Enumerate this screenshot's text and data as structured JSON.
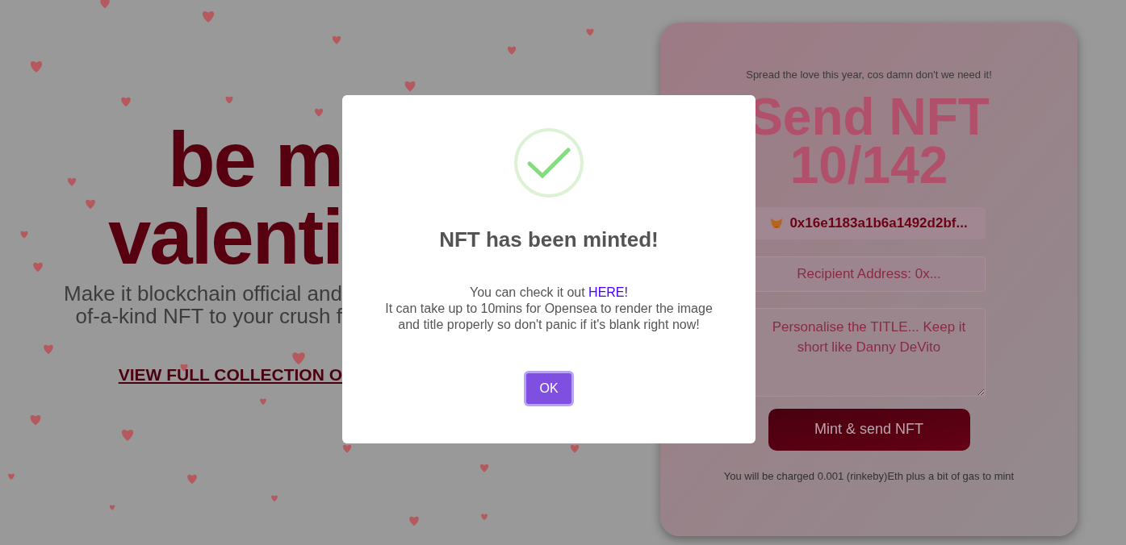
{
  "hero": {
    "title_lines": [
      "be m",
      "valenti"
    ],
    "subtitle_lines": [
      "Make it blockchain official and",
      "of-a-kind NFT to your crush f"
    ],
    "collection_link": "VIEW FULL COLLECTION O"
  },
  "mint_card": {
    "tagline": "Spread the love this year, cos damn don't we need it!",
    "heading_lines": [
      "Send NFT",
      "10/142"
    ],
    "wallet_address": "0x16e1183a1b6a1492d2bf...",
    "recipient_field": {
      "placeholder": "Recipient Address: 0x..."
    },
    "title_field": {
      "placeholder": "Personalise the TITLE... Keep it short like Danny DeVito"
    },
    "mint_button": "Mint & send NFT",
    "fee_note": "You will be charged 0.001 (rinkeby)Eth plus a bit of gas to mint"
  },
  "dialog": {
    "title": "NFT has been minted!",
    "message_lead": "You can check it out",
    "link": "HERE!",
    "message_body": "It can take up to 10mins for Opensea to render the image and title properly so don't panic if it's blank right now!",
    "button": "OK"
  }
}
